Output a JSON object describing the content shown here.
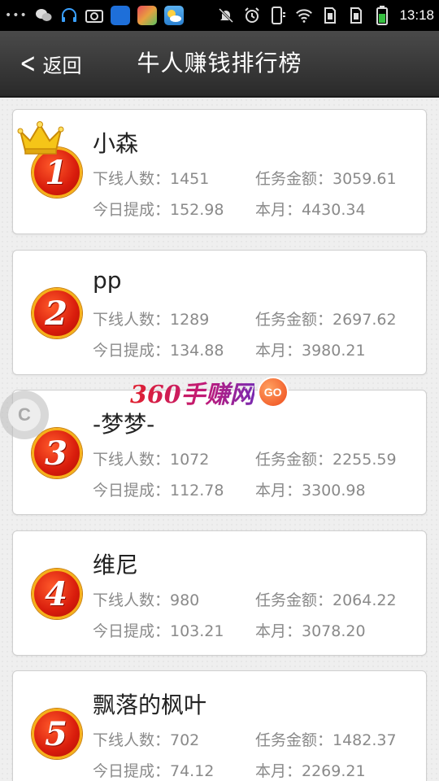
{
  "status_bar": {
    "time": "13:18",
    "dots": "•••",
    "left_icons": [
      "wechat-icon",
      "headset-icon",
      "camera-icon",
      "app-blue-icon",
      "app-colorful-icon",
      "weather-icon"
    ],
    "right_icons": [
      "mute-icon",
      "alarm-icon",
      "phone-signal-icon",
      "wifi-icon",
      "sim1-icon",
      "sim2-icon",
      "battery-icon"
    ],
    "app_colors": [
      "#1e6fd9",
      "#e8a040",
      "#3aa0e0"
    ]
  },
  "header": {
    "back_label": "返回",
    "title": "牛人赚钱排行榜"
  },
  "watermark": {
    "text": "360手赚网",
    "badge": "GO"
  },
  "float_button": {
    "glyph": "C"
  },
  "ranking": [
    {
      "rank": "1",
      "name": "小森",
      "downline": "下线人数：1451",
      "task_amount": "任务金额：3059.61",
      "today": "今日提成：152.98",
      "month": "本月：4430.34",
      "crown": true
    },
    {
      "rank": "2",
      "name": "pp",
      "downline": "下线人数：1289",
      "task_amount": "任务金额：2697.62",
      "today": "今日提成：134.88",
      "month": "本月：3980.21",
      "crown": false
    },
    {
      "rank": "3",
      "name": "-梦梦-",
      "downline": "下线人数：1072",
      "task_amount": "任务金额：2255.59",
      "today": "今日提成：112.78",
      "month": "本月：3300.98",
      "crown": false
    },
    {
      "rank": "4",
      "name": "维尼",
      "downline": "下线人数：980",
      "task_amount": "任务金额：2064.22",
      "today": "今日提成：103.21",
      "month": "本月：3078.20",
      "crown": false
    },
    {
      "rank": "5",
      "name": "飘落的枫叶",
      "downline": "下线人数：702",
      "task_amount": "任务金额：1482.37",
      "today": "今日提成：74.12",
      "month": "本月：2269.21",
      "crown": false
    }
  ]
}
